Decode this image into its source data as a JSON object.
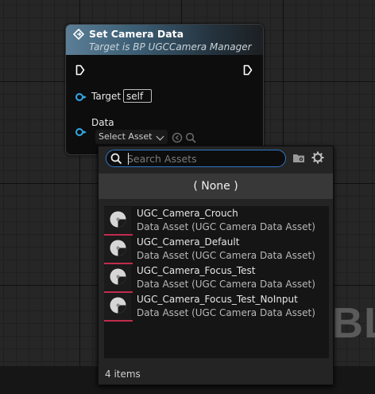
{
  "background": {
    "watermark": "BL"
  },
  "node": {
    "title": "Set Camera Data",
    "subtitle": "Target is BP UGCCamera Manager",
    "target_label": "Target",
    "target_value": "self",
    "data_label": "Data",
    "select_asset_label": "Select Asset",
    "pin_color": "#30a9e8"
  },
  "picker": {
    "search_placeholder": "Search Assets",
    "none_option": "( None )",
    "assets": [
      {
        "name": "UGC_Camera_Crouch",
        "type": "Data Asset (UGC Camera Data Asset)"
      },
      {
        "name": "UGC_Camera_Default",
        "type": "Data Asset (UGC Camera Data Asset)"
      },
      {
        "name": "UGC_Camera_Focus_Test",
        "type": "Data Asset (UGC Camera Data Asset)"
      },
      {
        "name": "UGC_Camera_Focus_Test_NoInput",
        "type": "Data Asset (UGC Camera Data Asset)"
      }
    ],
    "item_count": "4 items",
    "accent_color": "#2d76c9",
    "asset_bar_color": "#c12c4e"
  }
}
